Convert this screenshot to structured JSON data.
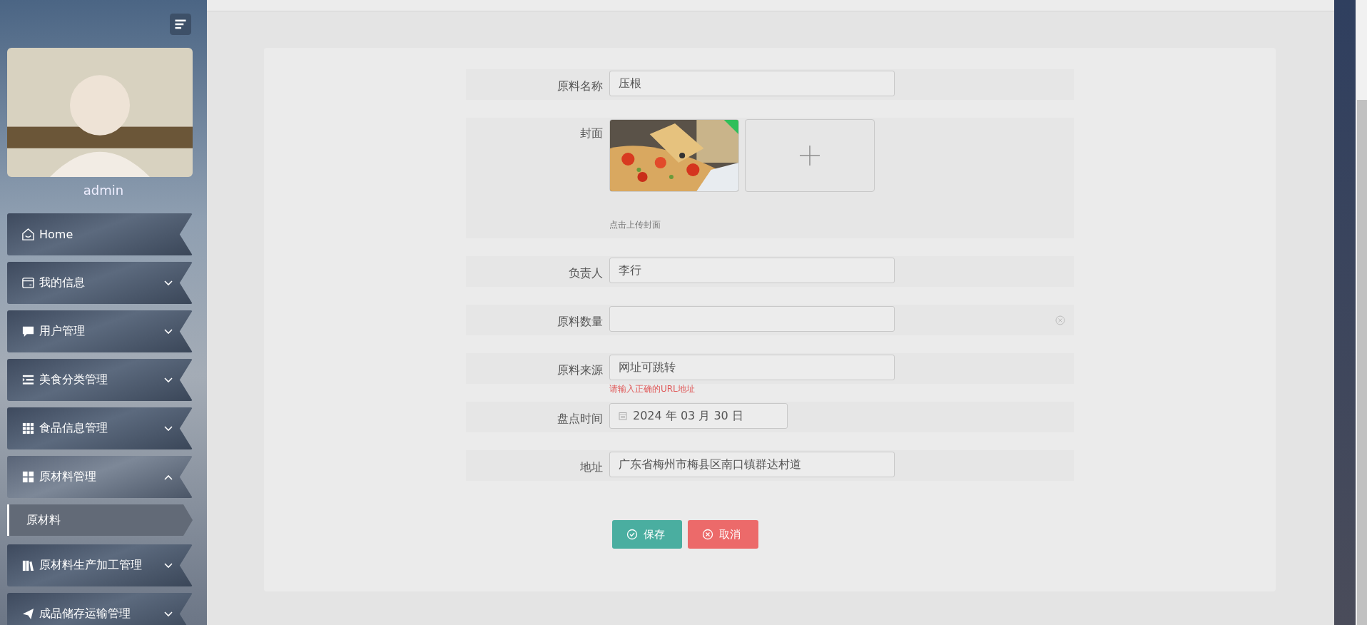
{
  "sidebar": {
    "user": "admin",
    "items": [
      {
        "label": "Home",
        "expandable": false,
        "expanded": false
      },
      {
        "label": "我的信息",
        "expandable": true,
        "expanded": false
      },
      {
        "label": "用户管理",
        "expandable": true,
        "expanded": false
      },
      {
        "label": "美食分类管理",
        "expandable": true,
        "expanded": false
      },
      {
        "label": "食品信息管理",
        "expandable": true,
        "expanded": false
      },
      {
        "label": "原材料管理",
        "expandable": true,
        "expanded": true,
        "children": [
          {
            "label": "原材料",
            "selected": true
          }
        ]
      },
      {
        "label": "原材料生产加工管理",
        "expandable": true,
        "expanded": false
      },
      {
        "label": "成品储存运输管理",
        "expandable": true,
        "expanded": false
      }
    ]
  },
  "form": {
    "fields": [
      {
        "kind": "text",
        "label": "原料名称",
        "value": "压根"
      },
      {
        "kind": "upload",
        "label": "封面",
        "hint": "点击上传封面"
      },
      {
        "kind": "text",
        "label": "负责人",
        "value": "李行"
      },
      {
        "kind": "text",
        "label": "原料数量",
        "clearable": true
      },
      {
        "kind": "text",
        "label": "原料来源",
        "value": "网址可跳转",
        "error": "请输入正确的URL地址"
      },
      {
        "kind": "date",
        "label": "盘点时间",
        "value": "2024 年 03 月 30 日"
      },
      {
        "kind": "text",
        "label": "地址",
        "value": "广东省梅州市梅县区南口镇群达村道"
      }
    ],
    "buttons": [
      {
        "kind": "save",
        "label": "保存"
      },
      {
        "kind": "cancel",
        "label": "取消"
      }
    ]
  }
}
